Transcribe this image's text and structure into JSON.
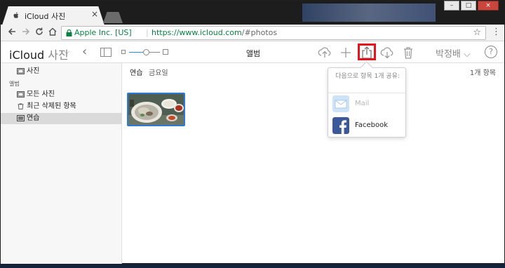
{
  "browser": {
    "tab_title": "iCloud 사진",
    "tab_close": "×",
    "security_label": "Apple Inc. [US]",
    "url_host": "https://www.icloud.com",
    "url_path": "/#photos",
    "star": "☆",
    "menu": "⋮",
    "window_controls": [
      "–",
      "□",
      "×"
    ]
  },
  "app": {
    "brand": "iCloud",
    "app_name": "사진",
    "chevron": "⌵",
    "back": "‹",
    "album_title": "앨범",
    "user": "박정배 ⌵",
    "help": "?",
    "zoom_level": 0.55
  },
  "sidebar": {
    "top_item": "사진",
    "section": "앨범",
    "items": [
      "모든 사진",
      "최근 삭제된 항목",
      "연습"
    ],
    "selected_index": 2
  },
  "main": {
    "filters": [
      "연습",
      "금요일"
    ],
    "count": "1개 항목"
  },
  "share_popover": {
    "heading": "다음으로 항목 1개 공유:",
    "items": [
      {
        "label": "Mail",
        "enabled": false
      },
      {
        "label": "Facebook",
        "enabled": true
      }
    ]
  },
  "colors": {
    "accent": "#1e8ef0",
    "highlight": "#e5131b",
    "facebook": "#3b5998",
    "secure": "#0b8043"
  }
}
